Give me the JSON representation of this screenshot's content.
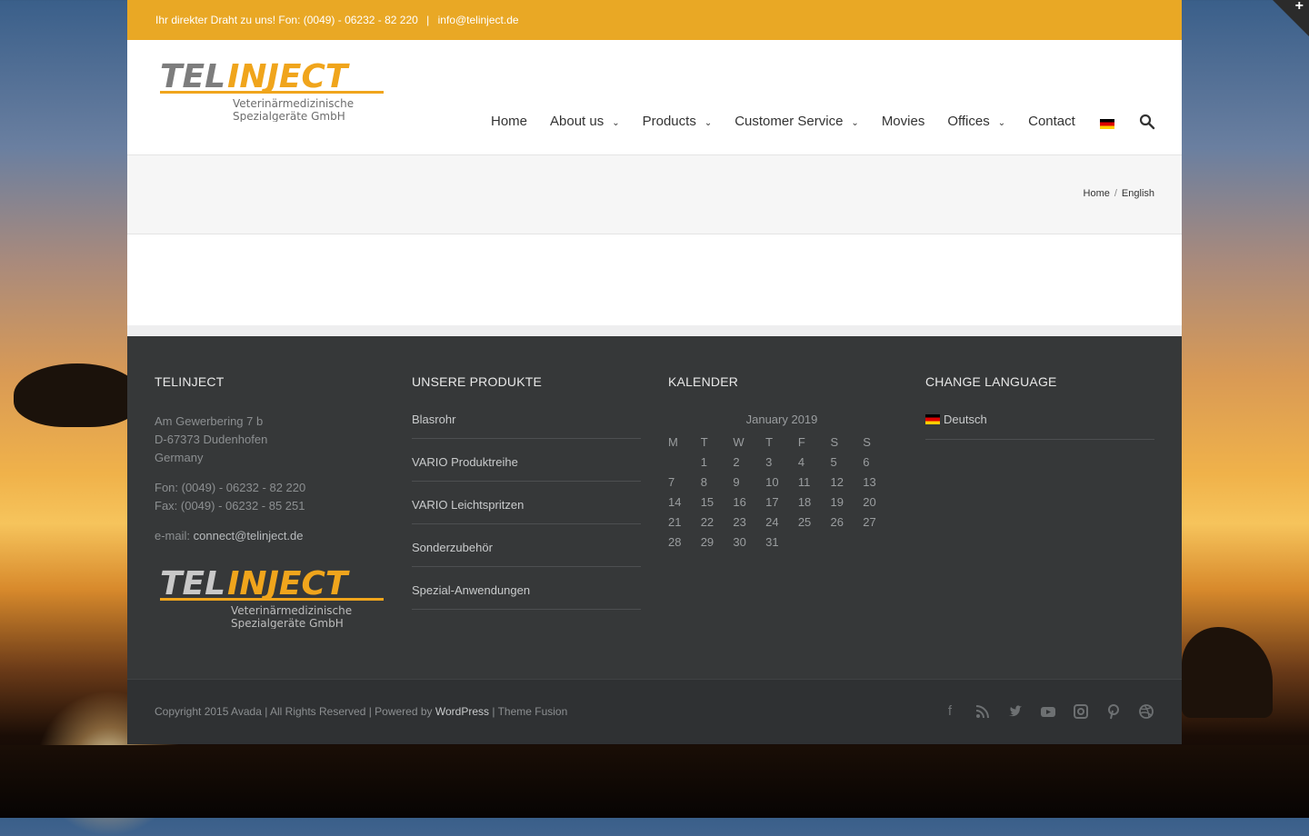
{
  "topbar": {
    "contact_text": "Ihr direkter Draht zu uns! Fon: (0049) - 06232 - 82 220",
    "separator": "|",
    "email": "info@telinject.de"
  },
  "logo": {
    "brand_part1": "TEL",
    "brand_part2": "INJECT",
    "subtitle_line1": "Veterinärmedizinische",
    "subtitle_line2": "Spezialgeräte GmbH"
  },
  "nav": {
    "items": [
      {
        "label": "Home",
        "has_dropdown": false
      },
      {
        "label": "About us",
        "has_dropdown": true
      },
      {
        "label": "Products",
        "has_dropdown": true
      },
      {
        "label": "Customer Service",
        "has_dropdown": true
      },
      {
        "label": "Movies",
        "has_dropdown": false
      },
      {
        "label": "Offices",
        "has_dropdown": true
      },
      {
        "label": "Contact",
        "has_dropdown": false
      }
    ],
    "language_flag": "german-flag-icon",
    "search_icon": "search-icon"
  },
  "breadcrumb": {
    "home": "Home",
    "divider": "/",
    "current": "English"
  },
  "footer": {
    "col1": {
      "title": "TELINJECT",
      "street": "Am Gewerbering 7 b",
      "city": "D-67373 Dudenhofen",
      "country": "Germany",
      "phone": "Fon: (0049) - 06232 - 82 220",
      "fax": "Fax: (0049) - 06232 - 85 251",
      "email_label": "e-mail: ",
      "email": "connect@telinject.de"
    },
    "col2": {
      "title": "UNSERE PRODUKTE",
      "items": [
        "Blasrohr",
        "VARIO Produktreihe",
        "VARIO Leichtspritzen",
        "Sonderzubehör",
        "Spezial-Anwendungen"
      ]
    },
    "col3": {
      "title": "KALENDER",
      "caption": "January 2019",
      "weekdays": [
        "M",
        "T",
        "W",
        "T",
        "F",
        "S",
        "S"
      ],
      "weeks": [
        [
          "",
          "1",
          "2",
          "3",
          "4",
          "5",
          "6"
        ],
        [
          "7",
          "8",
          "9",
          "10",
          "11",
          "12",
          "13"
        ],
        [
          "14",
          "15",
          "16",
          "17",
          "18",
          "19",
          "20"
        ],
        [
          "21",
          "22",
          "23",
          "24",
          "25",
          "26",
          "27"
        ],
        [
          "28",
          "29",
          "30",
          "31",
          "",
          "",
          ""
        ]
      ]
    },
    "col4": {
      "title": "CHANGE LANGUAGE",
      "language": "Deutsch"
    }
  },
  "copyright": {
    "text_before": "Copyright 2015 Avada | All Rights Reserved | Powered by ",
    "wordpress": "WordPress",
    "text_middle": " | ",
    "theme": "Theme Fusion"
  },
  "socials": [
    "facebook-icon",
    "rss-icon",
    "twitter-icon",
    "youtube-icon",
    "instagram-icon",
    "pinterest-icon",
    "dribbble-icon"
  ],
  "colors": {
    "topbar": "#e9a825",
    "footer": "#363839",
    "copyright_bar": "#2f3133",
    "brand_orange": "#f0a51c",
    "brand_gray": "#7d7d7d"
  }
}
